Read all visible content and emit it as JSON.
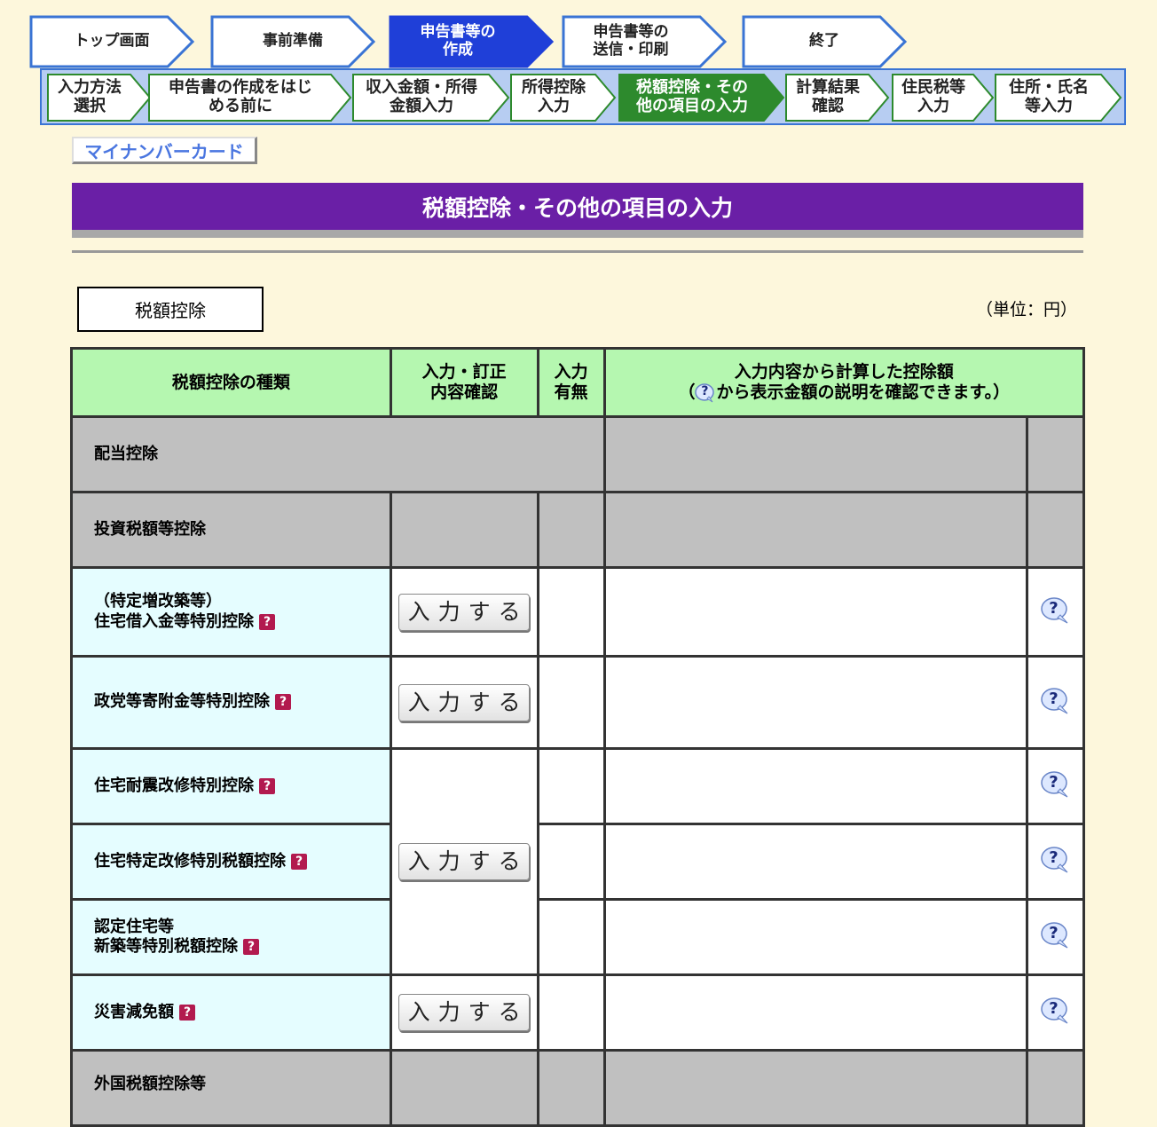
{
  "steps_main": [
    {
      "label": "トップ画面",
      "active": false
    },
    {
      "label": "事前準備",
      "active": false
    },
    {
      "label": "申告書等の\n作成",
      "active": true
    },
    {
      "label": "申告書等の\n送信・印刷",
      "active": false
    },
    {
      "label": "終了",
      "active": false
    }
  ],
  "steps_sub": [
    {
      "label": "入力方法\n選択",
      "active": false
    },
    {
      "label": "申告書の作成をはじ\nめる前に",
      "active": false
    },
    {
      "label": "収入金額・所得\n金額入力",
      "active": false
    },
    {
      "label": "所得控除\n入力",
      "active": false
    },
    {
      "label": "税額控除・その\n他の項目の入力",
      "active": true
    },
    {
      "label": "計算結果\n確認",
      "active": false
    },
    {
      "label": "住民税等\n入力",
      "active": false
    },
    {
      "label": "住所・氏名\n等入力",
      "active": false
    }
  ],
  "mynumber_label": "マイナンバーカード",
  "page_title": "税額控除・その他の項目の入力",
  "section_label": "税額控除",
  "unit_label": "（単位：円）",
  "table": {
    "headers": {
      "type": "税額控除の種類",
      "confirm": "入力・訂正\n内容確認",
      "status": "入力\n有無",
      "amount_prefix": "入力内容から計算した控除額",
      "amount_open": "（",
      "amount_suffix": "から表示金額の説明を確認できます。）"
    },
    "rows": {
      "dividend": "配当控除",
      "investment": "投資税額等控除",
      "housing_loan": "（特定増改築等）\n住宅借入金等特別控除",
      "political": "政党等寄附金等特別控除",
      "quake": "住宅耐震改修特別控除",
      "renovation": "住宅特定改修特別税額控除",
      "certified": "認定住宅等\n新築等特別税額控除",
      "disaster": "災害減免額",
      "foreign": "外国税額控除等"
    },
    "input_button_label": "入力する",
    "help_mark": "?"
  },
  "colors": {
    "background": "#fdf7dc",
    "title_bar": "#6a1fa6",
    "header_green": "#b5f7b0",
    "active_step_blue": "#1f3fd8",
    "active_substep_green": "#2d8a2d"
  }
}
